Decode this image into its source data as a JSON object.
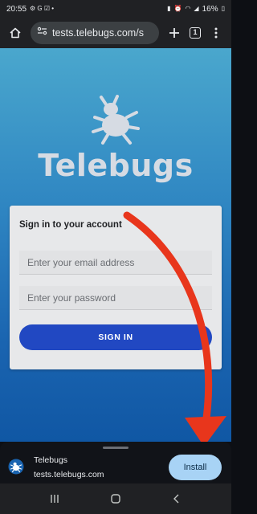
{
  "status_bar": {
    "time": "20:55",
    "battery": "16%"
  },
  "browser": {
    "url": "tests.telebugs.com/s",
    "tab_count": "1"
  },
  "page": {
    "brand": "Telebugs",
    "signin_card": {
      "title": "Sign in to your account",
      "email_placeholder": "Enter your email address",
      "password_placeholder": "Enter your password",
      "submit_label": "SIGN IN"
    }
  },
  "install_banner": {
    "app_name": "Telebugs",
    "app_url": "tests.telebugs.com",
    "install_label": "Install"
  },
  "colors": {
    "accent": "#2148c2",
    "arrow": "#e8361c",
    "install_button": "#a8d3f5"
  },
  "icons": [
    "home-icon",
    "site-info-icon",
    "new-tab-icon",
    "tab-switcher-icon",
    "more-menu-icon",
    "bug-logo-icon",
    "recents-icon",
    "home-nav-icon",
    "back-nav-icon"
  ]
}
